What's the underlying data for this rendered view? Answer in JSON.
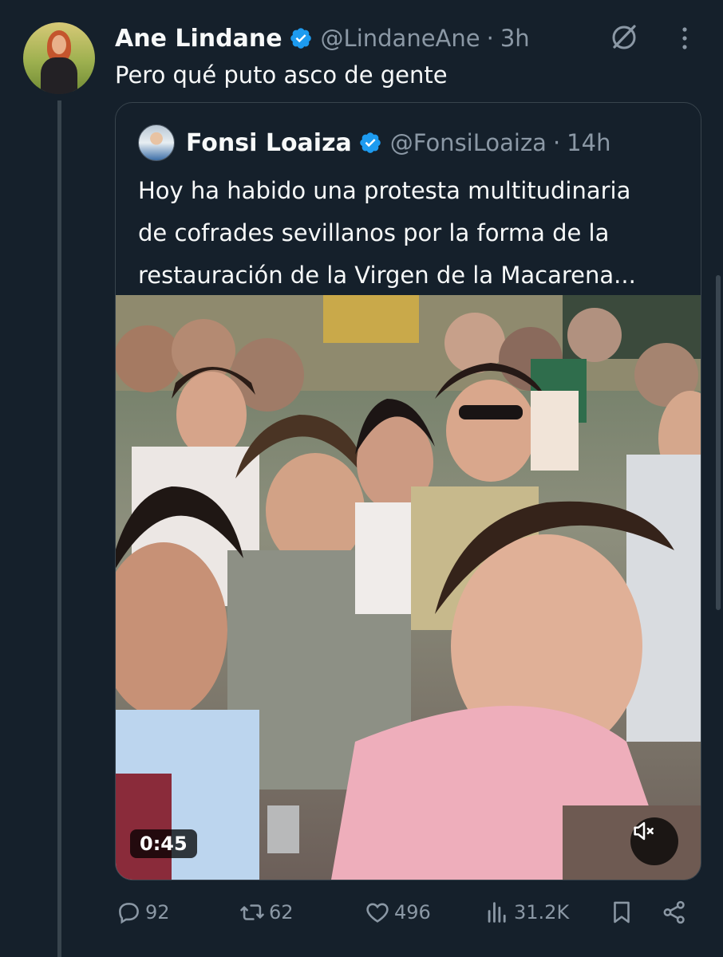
{
  "tweet": {
    "author_name": "Ane Lindane",
    "handle": "@LindaneAne",
    "separator": "·",
    "time": "3h",
    "text": "Pero qué puto asco de gente"
  },
  "quoted": {
    "author_name": "Fonsi Loaiza",
    "handle": "@FonsiLoaiza",
    "separator": "·",
    "time": "14h",
    "text_lines": [
      "Hoy ha habido una protesta multitudinaria",
      "de cofrades sevillanos por la forma de la",
      "restauración de la Virgen de la Macarena..."
    ],
    "video": {
      "duration": "0:45",
      "muted": true
    }
  },
  "actions": {
    "replies": "92",
    "reposts": "62",
    "likes": "496",
    "views": "31.2K"
  },
  "icons": {
    "verified": "verified-badge-icon",
    "grok": "grok-icon",
    "more": "more-vertical-icon",
    "reply": "reply-icon",
    "repost": "repost-icon",
    "like": "heart-icon",
    "views": "views-icon",
    "bookmark": "bookmark-icon",
    "share": "share-icon",
    "mute": "volume-muted-icon"
  },
  "colors": {
    "background": "#15202b",
    "text": "#f7f9f9",
    "secondary": "#8b98a5",
    "verified": "#1d9bf0",
    "border": "#38444d"
  }
}
